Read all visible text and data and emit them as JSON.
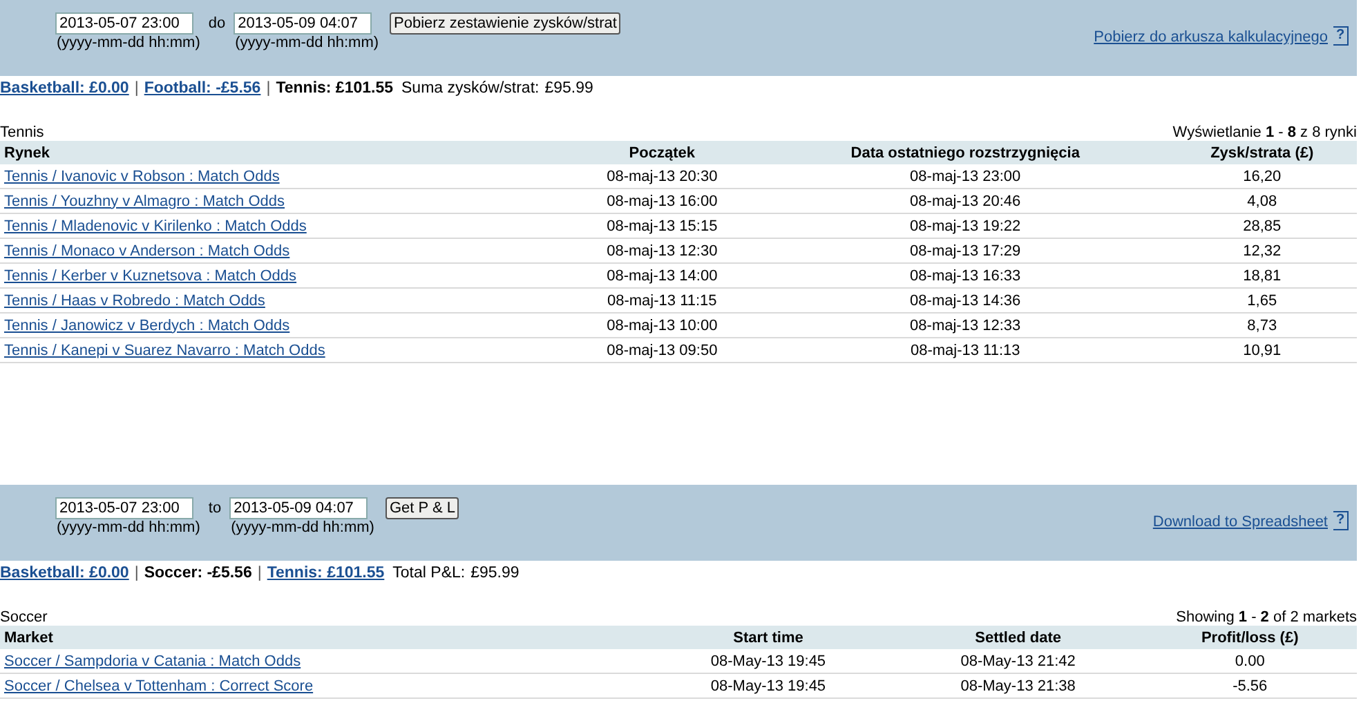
{
  "panels": [
    {
      "from_date": "2013-05-07 23:00",
      "range_word": "do",
      "to_date": "2013-05-09 04:07",
      "from_hint": "(yyyy-mm-dd hh:mm)",
      "to_hint": "(yyyy-mm-dd hh:mm)",
      "button": "Pobierz zestawienie zysków/strat",
      "download_link": "Pobierz do arkusza kalkulacyjnego",
      "help_glyph": "?",
      "summary": {
        "separator": "|",
        "sports": [
          {
            "label": "Basketball: £0.00",
            "selected": false
          },
          {
            "label": "Football: -£5.56",
            "selected": false
          },
          {
            "label": "Tennis: £101.55",
            "selected": true
          }
        ],
        "total_label": "Suma zysków/strat:",
        "total_value": "£95.99"
      },
      "section_title": "Tennis",
      "showing": "Wyświetlanie **1** - **8** z 8 rynki",
      "columns": [
        "Rynek",
        "Początek",
        "Data ostatniego rozstrzygnięcia",
        "Zysk/strata (£)"
      ],
      "rows": [
        [
          "Tennis / Ivanovic v Robson : Match Odds",
          "08-maj-13 20:30",
          "08-maj-13 23:00",
          "16,20"
        ],
        [
          "Tennis / Youzhny v Almagro : Match Odds",
          "08-maj-13 16:00",
          "08-maj-13 20:46",
          "4,08"
        ],
        [
          "Tennis / Mladenovic v Kirilenko : Match Odds",
          "08-maj-13 15:15",
          "08-maj-13 19:22",
          "28,85"
        ],
        [
          "Tennis / Monaco v Anderson : Match Odds",
          "08-maj-13 12:30",
          "08-maj-13 17:29",
          "12,32"
        ],
        [
          "Tennis / Kerber v Kuznetsova : Match Odds",
          "08-maj-13 14:00",
          "08-maj-13 16:33",
          "18,81"
        ],
        [
          "Tennis / Haas v Robredo : Match Odds",
          "08-maj-13 11:15",
          "08-maj-13 14:36",
          "1,65"
        ],
        [
          "Tennis / Janowicz v Berdych : Match Odds",
          "08-maj-13 10:00",
          "08-maj-13 12:33",
          "8,73"
        ],
        [
          "Tennis / Kanepi v Suarez Navarro : Match Odds",
          "08-maj-13 09:50",
          "08-maj-13 11:13",
          "10,91"
        ]
      ]
    },
    {
      "from_date": "2013-05-07 23:00",
      "range_word": "to",
      "to_date": "2013-05-09 04:07",
      "from_hint": "(yyyy-mm-dd hh:mm)",
      "to_hint": "(yyyy-mm-dd hh:mm)",
      "button": "Get P & L",
      "download_link": "Download to Spreadsheet",
      "help_glyph": "?",
      "summary": {
        "separator": "|",
        "sports": [
          {
            "label": "Basketball: £0.00",
            "selected": false
          },
          {
            "label": "Soccer: -£5.56",
            "selected": true
          },
          {
            "label": "Tennis: £101.55",
            "selected": false
          }
        ],
        "total_label": "Total P&L:",
        "total_value": "£95.99"
      },
      "section_title": "Soccer",
      "showing": "Showing **1** - **2** of 2 markets",
      "columns": [
        "Market",
        "Start time",
        "Settled date",
        "Profit/loss (£)"
      ],
      "rows": [
        [
          "Soccer / Sampdoria v Catania : Match Odds",
          "08-May-13 19:45",
          "08-May-13 21:42",
          "0.00"
        ],
        [
          "Soccer / Chelsea v Tottenham : Correct Score",
          "08-May-13 19:45",
          "08-May-13 21:38",
          "-5.56"
        ]
      ]
    }
  ]
}
